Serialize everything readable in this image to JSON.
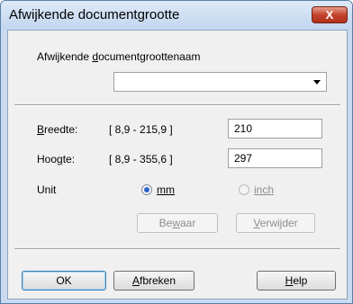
{
  "window": {
    "title": "Afwijkende documentgrootte",
    "close_label": "X"
  },
  "name_field": {
    "label": "Afwijkende documentgrootte",
    "label_underline": "d",
    "label_rest": "ocumentgroottenaam",
    "value": ""
  },
  "width": {
    "label_u": "B",
    "label_rest": "reedte:",
    "range": "[ 8,9 -  215,9 ]",
    "value": "210"
  },
  "height": {
    "label_pre": "Hoo",
    "label_u": "g",
    "label_rest": "te:",
    "range": "[ 8,9 -  355,6 ]",
    "value": "297"
  },
  "unit": {
    "label": "Unit",
    "options": [
      {
        "label": "mm",
        "selected": true,
        "enabled": true
      },
      {
        "label": "inch",
        "selected": false,
        "enabled": false
      }
    ]
  },
  "actions": {
    "save_pre": "Be",
    "save_u": "w",
    "save_rest": "aar",
    "delete_u": "V",
    "delete_rest": "erwijder"
  },
  "footer": {
    "ok": "OK",
    "cancel_u": "A",
    "cancel_rest": "fbreken",
    "help_u": "H",
    "help_rest": "elp"
  }
}
